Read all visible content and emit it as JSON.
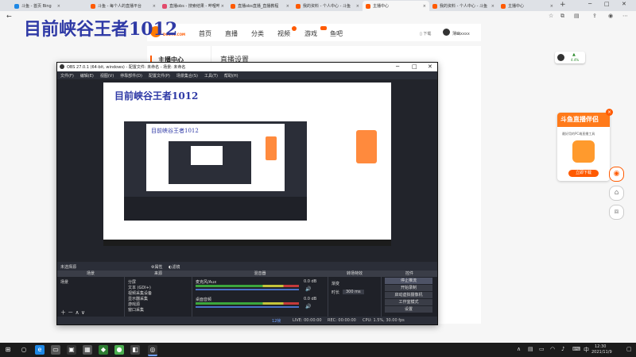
{
  "browser": {
    "tabs": [
      {
        "label": "斗鱼 - 首页 Bing",
        "color": "#1e88e5"
      },
      {
        "label": "斗鱼 - 每个人的直播平台",
        "color": "#ff5a00"
      },
      {
        "label": "直播obs - 搜索结果 - 哔哩哔哩",
        "color": "#e24a6b"
      },
      {
        "label": "直播obs直播_直播教程",
        "color": "#ff5a00"
      },
      {
        "label": "我的资料 - 个人中心 - 斗鱼",
        "color": "#ff5a00"
      },
      {
        "label": "主播中心",
        "color": "#ff5a00"
      },
      {
        "label": "我的资料 - 个人中心 - 斗鱼",
        "color": "#ff5a00"
      },
      {
        "label": "主播中心",
        "color": "#ff5a00"
      }
    ],
    "new_tab": "+"
  },
  "watermark": "目前峡谷王者1012",
  "site": {
    "logo_text": "DOUYU.COM",
    "nav": [
      "首页",
      "直播",
      "分类",
      "视频",
      "游戏",
      "鱼吧"
    ],
    "download": "下载",
    "user": "薄幽xxxx",
    "left_nav_title": "主播中心",
    "content_title": "直播设置"
  },
  "obs": {
    "title": "OBS 27.0.1 (64-bit, windows) - 配置文件: 未命名 - 场景: 未命名",
    "menu": [
      "文件(F)",
      "编辑(E)",
      "视图(V)",
      "停靠部件(D)",
      "配置文件(P)",
      "场景集合(S)",
      "工具(T)",
      "帮助(H)"
    ],
    "status_left": "未选择源",
    "status_btn1": "属性",
    "status_btn2": "滤镜",
    "docks": {
      "scenes": {
        "title": "场景",
        "items": [
          "场景"
        ]
      },
      "sources": {
        "title": "来源",
        "items": [
          "分屏",
          "文本 (GDI+)",
          "视频采集设备",
          "显示器采集",
          "游戏源",
          "窗口采集"
        ]
      },
      "mixer": {
        "title": "混音器",
        "ch1": "麦克风/Aux",
        "ch1_db": "0.0 dB",
        "ch2": "桌面音频",
        "ch2_db": "0.0 dB"
      },
      "transitions": {
        "title": "转场特效",
        "mode": "渐变",
        "duration_label": "时长",
        "duration": "300 ms"
      },
      "controls": {
        "title": "控件",
        "buttons": [
          "停止推流",
          "开始录制",
          "启动虚拟摄像机",
          "工作室模式",
          "设置",
          "退出"
        ]
      }
    },
    "bottom": {
      "live": "LIVE: 00:00:00",
      "rec": "REC: 00:00:00",
      "cpu": "CPU: 1.5%, 30.00 fps",
      "dropped": "12帧"
    }
  },
  "float_badge": "4.4%",
  "promo": {
    "title": "斗鱼直播伴侣",
    "subtitle": "最好用的PC端直播工具",
    "button": "立即下载"
  },
  "taskbar": {
    "time": "12:30",
    "date": "2021/11/9"
  }
}
